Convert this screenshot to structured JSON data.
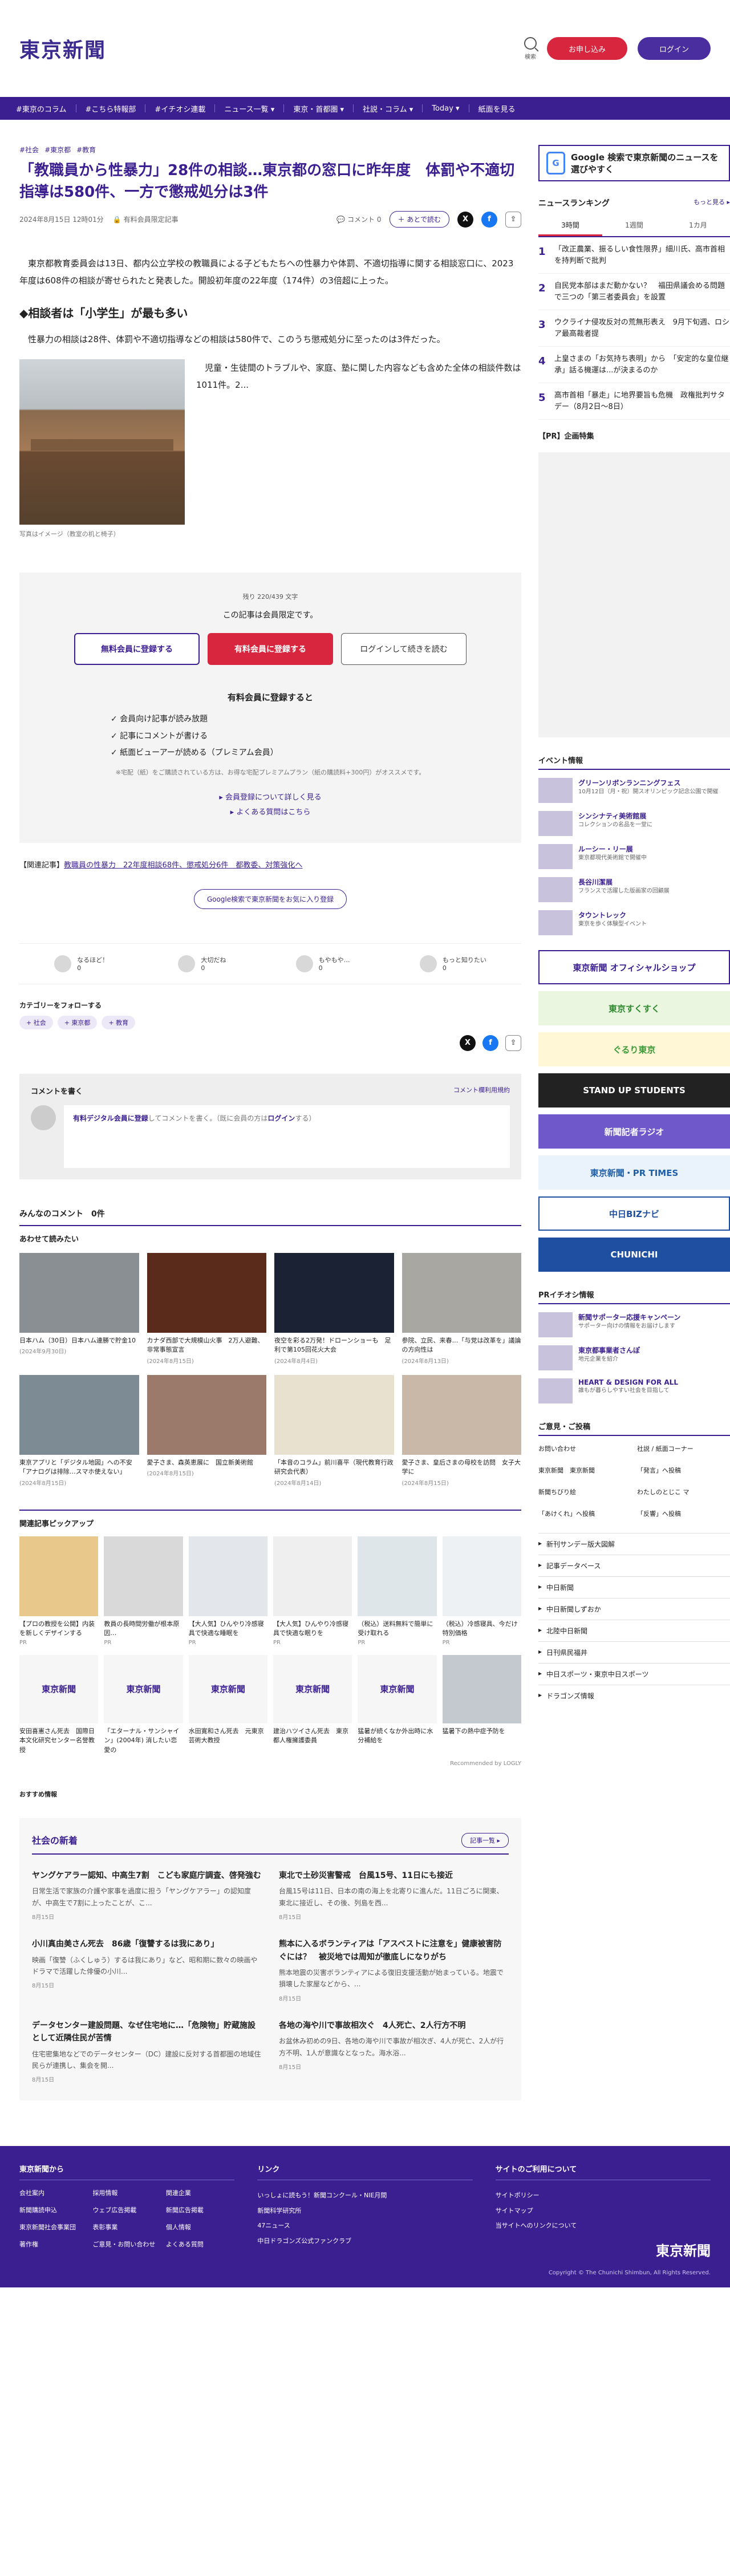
{
  "header": {
    "logo": "東京新聞",
    "search_label": "検索",
    "subscribe": "お申し込み",
    "login": "ログイン"
  },
  "nav": [
    "#東京のコラム",
    "#こちら特報部",
    "#イチオシ連載",
    "ニュース一覧 ▾",
    "東京・首都圏 ▾",
    "社説・コラム ▾",
    "Today ▾",
    "紙面を見る"
  ],
  "article": {
    "tags": [
      "#社会",
      "#東京都",
      "#教育"
    ],
    "title": "「教職員から性暴力」28件の相談…東京都の窓口に昨年度　体罰や不適切指導は580件、一方で懲戒処分は3件",
    "date": "2024年8月15日 12時01分",
    "badge": "有料会員限定記事",
    "comment_label": "コメント",
    "comment_count": "0",
    "later_label": "あとで読む",
    "lead": "東京都教育委員会は13日、都内公立学校の教職員による子どもたちへの性暴力や体罰、不適切指導に関する相談窓口に、2023年度は608件の相談が寄せられたと発表した。開設初年度の22年度（174件）の3倍超に上った。",
    "subhead": "◆相談者は「小学生」が最も多い",
    "para1": "性暴力の相談は28件、体罰や不適切指導などの相談は580件で、このうち懲戒処分に至ったのは3件だった。",
    "para2": "児童・生徒間のトラブルや、家庭、塾に関した内容なども含めた全体の相談件数は1011件。2...",
    "caption": "写真はイメージ（教室の机と椅子）"
  },
  "paywall": {
    "remaining": "残り 220/439 文字",
    "notice": "この記事は会員限定です。",
    "btn_free": "無料会員に登録する",
    "btn_paid": "有料会員に登録する",
    "btn_login": "ログインして続きを読む",
    "benefit_title": "有料会員に登録すると",
    "benefits": [
      "✓ 会員向け記事が読み放題",
      "✓ 記事にコメントが書ける",
      "✓ 紙面ビューアーが読める（プレミアム会員）"
    ],
    "note": "※宅配（紙）をご購読されている方は、お得な宅配プレミアムプラン（紙の購読料+300円）がオススメです。",
    "link1": "▸ 会員登録について詳しく見る",
    "link2": "▸ よくある質問はこちら"
  },
  "related": {
    "label": "【関連記事】",
    "link": "教職員の性暴力　22年度相談68件、懲戒処分6件　都教委、対策強化へ"
  },
  "gnews_btn": "Google検索で東京新聞をお気に入り登録",
  "reactions": [
    {
      "label": "なるほど！",
      "count": "0"
    },
    {
      "label": "大切だね",
      "count": "0"
    },
    {
      "label": "もやもや…",
      "count": "0"
    },
    {
      "label": "もっと知りたい",
      "count": "0"
    }
  ],
  "categories": {
    "title": "カテゴリーをフォローする",
    "chips": [
      "+ 社会",
      "+ 東京都",
      "+ 教育"
    ]
  },
  "comment": {
    "title": "コメントを書く",
    "rule": "コメント欄利用規約",
    "prompt_link": "有料デジタル会員に登録",
    "prompt_text": "してコメントを書く。（既に会員の方は",
    "prompt_login": "ログイン",
    "prompt_end": "する）"
  },
  "everyone_comments": {
    "title": "みんなのコメント",
    "count": "0件"
  },
  "also_read": {
    "title": "あわせて読みたい",
    "cards": [
      {
        "title": "日本ハム（30日）日本ハム連勝で貯金10",
        "date": "(2024年9月30日)"
      },
      {
        "title": "カナダ西部で大規模山火事　2万人避難、非常事態宣言",
        "date": "(2024年8月15日)"
      },
      {
        "title": "夜空を彩る2万発！ドローンショーも　足利で第105回花火大会",
        "date": "(2024年8月4日)"
      },
      {
        "title": "参院、立民、来春…「与党は改革を」議論の方向性は",
        "date": "(2024年8月13日)"
      },
      {
        "title": "東京アプリと「デジタル地図」への不安　「アナログは排除…スマホ使えない」",
        "date": "(2024年8月15日)"
      },
      {
        "title": "愛子さま、森英恵展に　国立新美術館",
        "date": "(2024年8月15日)"
      },
      {
        "title": "「本音のコラム」前川喜平（現代教育行政研究会代表）",
        "date": "(2024年8月14日)"
      },
      {
        "title": "愛子さま、皇后さまの母校を訪問　女子大学に",
        "date": "(2024年8月15日)"
      }
    ]
  },
  "pickup": {
    "title": "関連記事ピックアップ",
    "tiles": [
      {
        "title": "【プロの教授を公開】内装を新しくデザインする",
        "src": "PR"
      },
      {
        "title": "教員の長時間労働が根本原因…",
        "src": "PR"
      },
      {
        "title": "【大人気】ひんやり冷感寝具で快適な睡眠を",
        "src": "PR"
      },
      {
        "title": "【大人気】ひんやり冷感寝具で快適な眠りを",
        "src": "PR"
      },
      {
        "title": "（税込）送料無料で簡単に受け取れる",
        "src": "PR"
      },
      {
        "title": "（税込）冷感寝具、今だけ特別価格",
        "src": "PR"
      },
      {
        "title": "安田喜憲さん死去　国際日本文化研究センター名誉教授",
        "src": "東京新聞"
      },
      {
        "title": "「エターナル・サンシャイン」(2004年) 消したい恋愛の",
        "src": "東京新聞"
      },
      {
        "title": "水田寛和さん死去　元東京芸術大教授",
        "src": "東京新聞"
      },
      {
        "title": "建治ハツイさん死去　東京都人権擁護委員",
        "src": "東京新聞"
      },
      {
        "title": "猛暑が続くなか外出時に水分補給を",
        "src": "東京新聞"
      },
      {
        "title": "猛暑下の熱中症予防を",
        "src": "東京新聞"
      }
    ],
    "powered": "Recommended by LOGLY"
  },
  "recommend_label": "おすすめ情報",
  "cat_news": {
    "title": "社会の新着",
    "more": "記事一覧 ▸",
    "items": [
      {
        "title": "ヤングケアラー認知、中高生7割　こども家庭庁調査、啓発強む",
        "body": "日常生活で家族の介護や家事を過度に担う「ヤングケアラー」の認知度が、中高生で7割に上ったことが、こ...",
        "date": "8月15日"
      },
      {
        "title": "東北で土砂災害警戒　台風15号、11日にも接近",
        "body": "台風15号は11日、日本の南の海上を北寄りに進んだ。11日ごろに関東、東北に接近し、その後、列島を西...",
        "date": "8月15日"
      },
      {
        "title": "小川真由美さん死去　86歳「復讐するは我にあり」",
        "body": "映画「復讐（ふくしゅう）するは我にあり」など、昭和期に数々の映画やドラマで活躍した俳優の小川...",
        "date": "8月15日"
      },
      {
        "title": "熊本に入るボランティアは「アスベストに注意を」健康被害防ぐには？　被災地では周知が徹底しになりがち",
        "body": "熊本地震の災害ボランティアによる復旧支援活動が始まっている。地震で損壊した家屋などから、...",
        "date": "8月15日"
      },
      {
        "title": "データセンター建設問題、なぜ住宅地に…「危険物」貯蔵施設として近隣住民が苦情",
        "body": "住宅密集地などでのデータセンター（DC）建設に反対する首都圏の地域住民らが連携し、集会を開...",
        "date": "8月15日"
      },
      {
        "title": "各地の海や川で事故相次ぐ　4人死亡、2人行方不明",
        "body": "お盆休み初めの9日、各地の海や川で事故が相次ぎ、4人が死亡、2人が行方不明、1人が意識なとなった。海水浴...",
        "date": "8月15日"
      }
    ]
  },
  "side": {
    "gnews": "Google 検索で東京新聞のニュースを選びやすく",
    "ranking_title": "ニュースランキング",
    "ranking_more": "もっと見る ▸",
    "tabs": [
      "3時間",
      "1週間",
      "1カ月"
    ],
    "ranks": [
      {
        "n": "1",
        "t": "「改正農業、振るしい食性限界」細川氏、高市首相を持判断で批判"
      },
      {
        "n": "2",
        "t": "自民党本部はまだ動かない？　福田県議会める問題で三つの「第三者委員会」を設置"
      },
      {
        "n": "3",
        "t": "ウクライナ侵攻反対の荒無形表え　9月下旬週、ロシア最高裁者提"
      },
      {
        "n": "4",
        "t": "上皇さまの「お気持ち表明」から　「安定的な皇位継承」話る機運は...が決まるのか"
      },
      {
        "n": "5",
        "t": "高市首相「暴走」に地界要旨も危機　政権批判サタデー（8月2日～8日）"
      }
    ],
    "pr_label": "【PR】企画特集",
    "event_title": "イベント情報",
    "events": [
      {
        "title": "グリーンリボンランニングフェス",
        "desc": "10月12日（月・祝）開スオリンピック記念公園で開催"
      },
      {
        "title": "シンシナティ美術館展",
        "desc": "コレクションの名品を一堂に"
      },
      {
        "title": "ルーシー・リー展",
        "desc": "東京都現代美術館で開催中"
      },
      {
        "title": "長谷川潔展",
        "desc": "フランスで活躍した版画家の回顧展"
      },
      {
        "title": "タウントレック",
        "desc": "東京を歩く体験型イベント"
      }
    ],
    "banners": [
      "東京新聞 オフィシャルショップ",
      "東京すくすく",
      "ぐるり東京",
      "STAND UP STUDENTS",
      "新聞記者ラジオ",
      "東京新聞・PR TIMES",
      "中日BIZナビ",
      "CHUNICHI"
    ],
    "pr_title": "PRイチオシ情報",
    "pr_items": [
      {
        "title": "新聞サポーター応援キャンペーン",
        "desc": "サポーター向けの情報をお届けします"
      },
      {
        "title": "東京都事業者さんぽ",
        "desc": "地元企業を紹介"
      },
      {
        "title": "HEART & DESIGN FOR ALL",
        "desc": "誰もが暮らしやすい社会を目指して"
      }
    ],
    "guide_title": "ご意見・ご投稿",
    "guide_links": [
      "お問い合わせ",
      "社説 / 紙面コーナー",
      "東京新聞　東京新聞",
      "「発言」へ投稿",
      "新聞ちびり絵",
      "わたしのとじこ マ",
      "「あけくれ」へ投稿",
      "「反響」へ投稿"
    ],
    "menu": [
      "新刊サンデー版大図解",
      "記事データベース",
      "中日新聞",
      "中日新聞しずおか",
      "北陸中日新聞",
      "日刊県民福井",
      "中日スポーツ・東京中日スポーツ",
      "ドラゴンズ情報"
    ]
  },
  "footer": {
    "col1_title": "東京新聞から",
    "col1_links": [
      "会社案内",
      "採用情報",
      "関連企業",
      "新聞購読申込",
      "ウェブ広告掲載",
      "新聞広告掲載",
      "東京新聞社会事業団",
      "表彰事業",
      "個人情報",
      "著作権",
      "ご意見・お問い合わせ",
      "よくある質問"
    ],
    "col2_title": "リンク",
    "col2_links": [
      "いっしょに読もう！新聞コンクール・NIE月間",
      "新聞科学研究所",
      "47ニュース",
      "中日ドラゴンズ公式ファンクラブ"
    ],
    "col3_title": "サイトのご利用について",
    "col3_links": [
      "サイトポリシー",
      "サイトマップ",
      "当サイトへのリンクについて"
    ],
    "logo": "東京新聞",
    "copyright": "Copyright © The Chunichi Shimbun, All Rights Reserved."
  },
  "colors": {
    "brand": "#3b1f91",
    "accent": "#d7263d"
  }
}
